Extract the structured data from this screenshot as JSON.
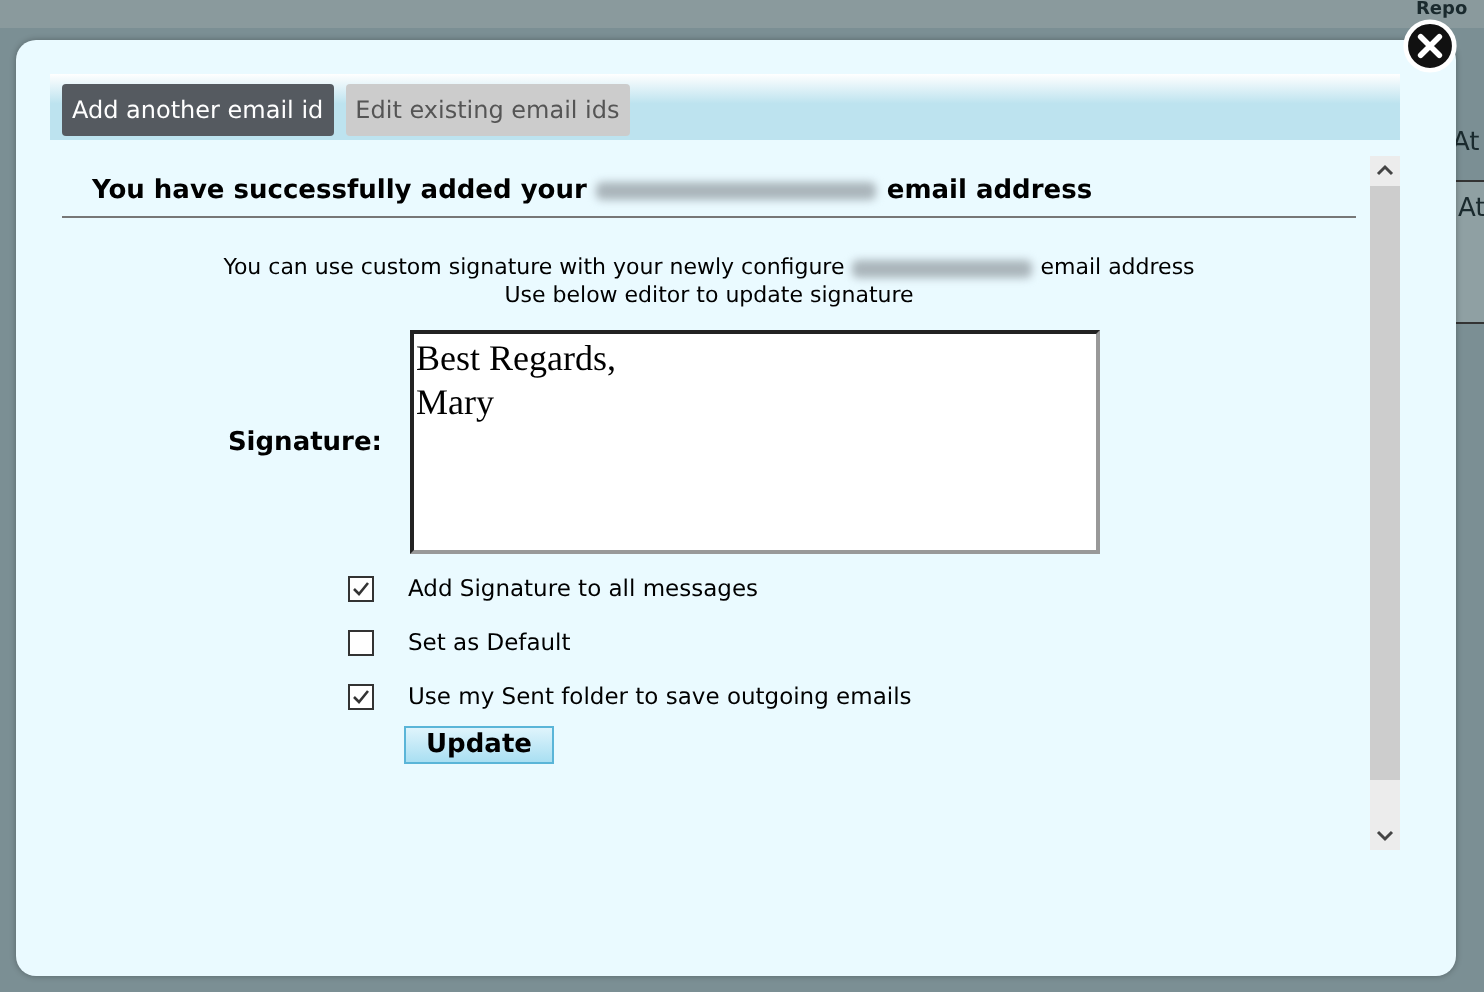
{
  "background": {
    "texts": [
      "Repo",
      "At",
      "At"
    ]
  },
  "tabs": [
    {
      "label": "Add another email id",
      "selected": true
    },
    {
      "label": "Edit existing email ids",
      "selected": false
    }
  ],
  "heading": {
    "before": "You have successfully added your",
    "after": "email address"
  },
  "info": {
    "line1_before": "You can use custom signature with your newly configure",
    "line1_after": "email address",
    "line2": "Use below editor to update signature"
  },
  "signature": {
    "label": "Signature:",
    "value": "Best Regards,\nMary"
  },
  "options": [
    {
      "label": "Add Signature to all messages",
      "checked": true
    },
    {
      "label": "Set as Default",
      "checked": false
    },
    {
      "label": "Use my Sent folder to save outgoing emails",
      "checked": true
    }
  ],
  "update_button": "Update"
}
